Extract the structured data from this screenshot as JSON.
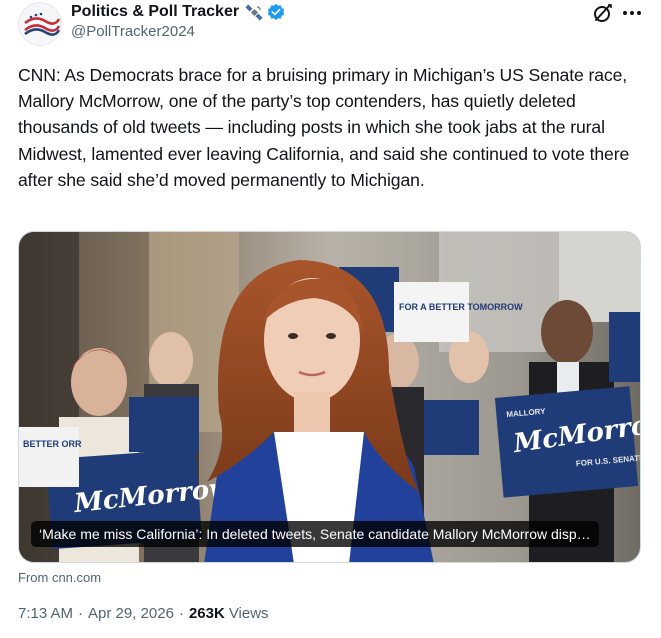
{
  "author": {
    "display_name": "Politics & Poll Tracker",
    "handle": "@PollTracker2024",
    "avatar_icon": "flag-swoosh-avatar",
    "badge_icon": "satellite-icon",
    "verified_icon": "verified-badge-icon",
    "verified_color": "#1d9bf0"
  },
  "actions": {
    "grok_icon": "grok-icon",
    "more_icon": "more-icon"
  },
  "tweet": {
    "text": "CNN: As Democrats brace for a bruising primary in Michigan’s US Senate race, Mallory McMorrow, one of the party’s top contenders, has quietly deleted thousands of old tweets — including posts in which she took jabs at the rural Midwest, lamented ever leaving California, and said she continued to vote there after she said she’d moved permanently to Michigan."
  },
  "card": {
    "caption": "‘Make me miss California’: In deleted tweets, Senate candidate Mallory McMorrow disp…",
    "source": "From cnn.com",
    "sign_text_main": "McMorrow",
    "sign_text_top": "MALLORY",
    "sign_text_bottom": "FOR U.S. SENATE",
    "sign_text_white": "FOR A BETTER TOMORROW",
    "sign_text_partial": "BETTER ORR",
    "sign_color": "#1f3c78"
  },
  "meta": {
    "time": "7:13 AM",
    "separator": "·",
    "date": "Apr 29, 2026",
    "views_count": "263K",
    "views_label": "Views"
  }
}
